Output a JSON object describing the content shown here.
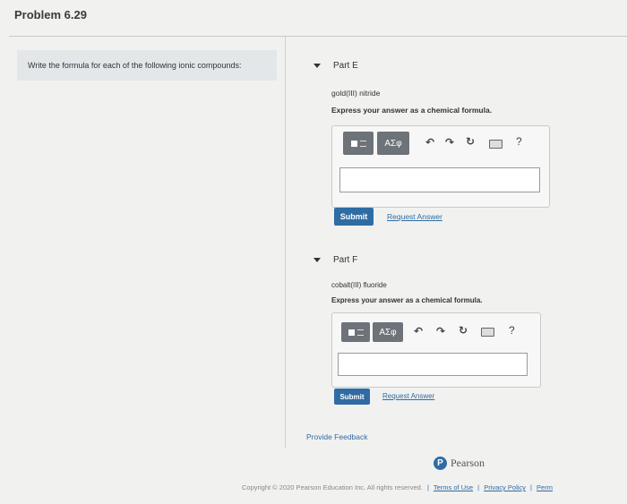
{
  "page": {
    "title": "Problem 6.29"
  },
  "instruction": "Write the formula for each of the following ionic compounds:",
  "parts": [
    {
      "label": "Part E",
      "compound": "gold(III) nitride",
      "prompt": "Express your answer as a chemical formula.",
      "toolbar": {
        "greek": "ΑΣφ",
        "help": "?"
      },
      "answer_value": "",
      "submit_label": "Submit",
      "request_label": "Request Answer"
    },
    {
      "label": "Part F",
      "compound": "cobalt(III) fluoride",
      "prompt": "Express your answer as a chemical formula.",
      "toolbar": {
        "greek": "ΑΣφ",
        "help": "?"
      },
      "answer_value": "",
      "submit_label": "Submit",
      "request_label": "Request Answer"
    }
  ],
  "feedback_label": "Provide Feedback",
  "brand": {
    "logo_letter": "P",
    "name": "Pearson"
  },
  "footer": {
    "copyright": "Copyright © 2020 Pearson Education Inc. All rights reserved.",
    "sep": "|",
    "terms": "Terms of Use",
    "privacy": "Privacy Policy",
    "perm": "Perm"
  },
  "colors": {
    "accent": "#2f6ca3",
    "button_dark": "#6d7378",
    "instruction_bg": "#e3e7ea"
  },
  "icons": [
    "template-icon",
    "undo-icon",
    "redo-icon",
    "reset-icon",
    "keyboard-icon",
    "help-icon",
    "collapse-caret-icon"
  ]
}
